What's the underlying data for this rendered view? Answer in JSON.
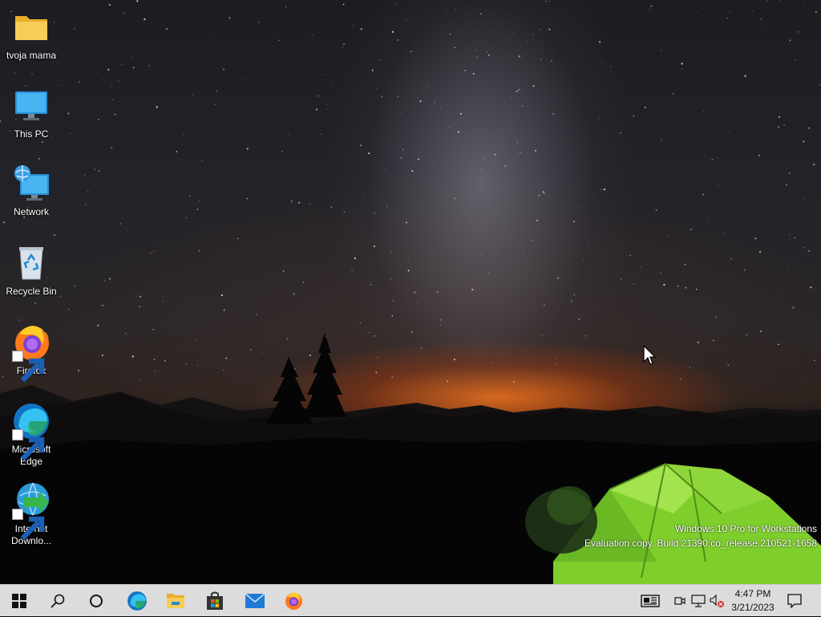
{
  "desktop": {
    "icons": [
      {
        "label": "tvoja mama",
        "icon": "folder-icon"
      },
      {
        "label": "This PC",
        "icon": "monitor-icon"
      },
      {
        "label": "Network",
        "icon": "network-icon"
      },
      {
        "label": "Recycle Bin",
        "icon": "recycle-bin-icon"
      },
      {
        "label": "Firefox",
        "icon": "firefox-icon"
      },
      {
        "label": "Microsoft Edge",
        "icon": "edge-icon"
      },
      {
        "label": "Internet Downlo...",
        "icon": "internet-download-manager-icon"
      }
    ],
    "watermark": {
      "line1": "Windows 10 Pro for Workstations",
      "line2": "Evaluation copy. Build 21390.co_release.210521-1658"
    }
  },
  "taskbar": {
    "buttons": [
      "start-icon",
      "search-icon",
      "cortana-icon",
      "edge-icon",
      "file-explorer-icon",
      "microsoft-store-icon",
      "mail-icon",
      "firefox-icon"
    ],
    "tray": [
      "news-icon",
      "meet-now-icon",
      "network-icon",
      "volume-muted-icon"
    ],
    "clock": {
      "time": "4:47 PM",
      "date": "3/21/2023"
    },
    "notification": "action-center-icon"
  },
  "colors": {
    "taskbar_bg": "#dcdcdc",
    "folder_yellow": "#f3c74a",
    "edge_blue": "#1273c4",
    "tent_green": "#8fd63a",
    "horizon_orange": "#e86b1a"
  }
}
